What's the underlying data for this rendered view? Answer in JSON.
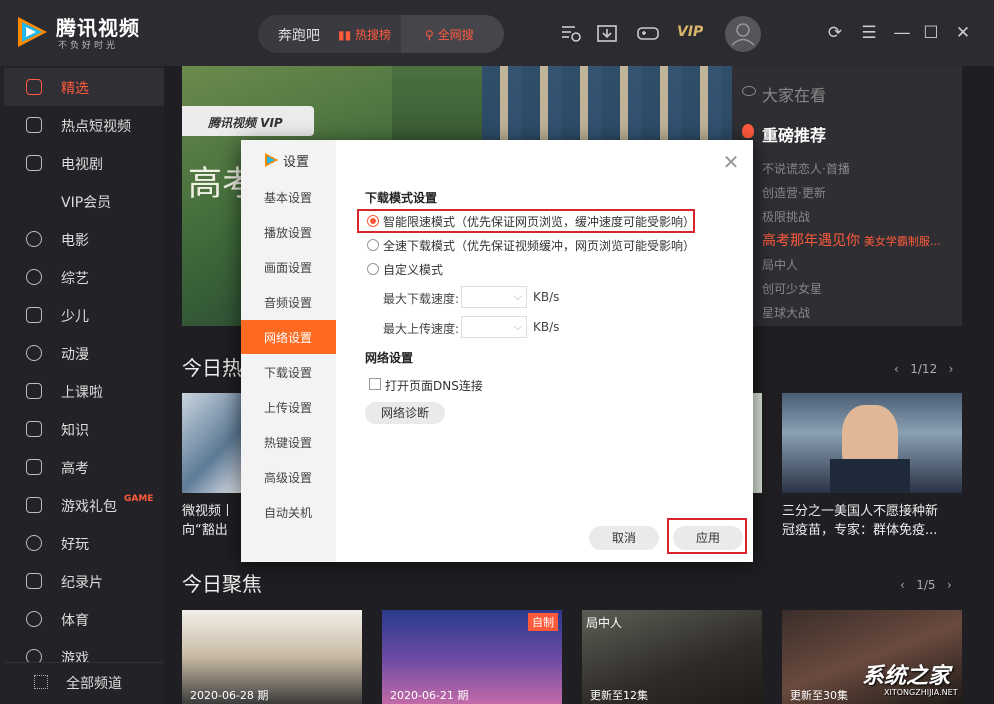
{
  "app": {
    "brand": "腾讯视频",
    "slogan": "不负好时光"
  },
  "topbar": {
    "search_text": "奔跑吧",
    "hot_search": "热搜榜",
    "full_search": "全网搜",
    "vip": "VIP",
    "icons": [
      "history-icon",
      "download-icon",
      "game-icon"
    ],
    "window_controls": [
      "refresh-icon",
      "menu-icon",
      "minimize-icon",
      "maximize-icon",
      "close-icon"
    ]
  },
  "sidebar": {
    "items": [
      {
        "label": "精选",
        "icon": "thumbs-up-icon"
      },
      {
        "label": "热点短视频",
        "icon": "flame-icon"
      },
      {
        "label": "电视剧",
        "icon": "tv-icon"
      },
      {
        "label": "VIP会员",
        "icon": ""
      },
      {
        "label": "电影",
        "icon": "film-reel-icon"
      },
      {
        "label": "综艺",
        "icon": "microphone-icon"
      },
      {
        "label": "少儿",
        "icon": "kids-icon"
      },
      {
        "label": "动漫",
        "icon": "bear-icon"
      },
      {
        "label": "上课啦",
        "icon": "graduation-cap-icon"
      },
      {
        "label": "知识",
        "icon": "book-icon"
      },
      {
        "label": "高考",
        "icon": "school-icon"
      },
      {
        "label": "游戏礼包",
        "icon": "gamepad-icon"
      },
      {
        "label": "好玩",
        "icon": "joystick-icon"
      },
      {
        "label": "纪录片",
        "icon": "camera-icon"
      },
      {
        "label": "体育",
        "icon": "basketball-icon"
      },
      {
        "label": "游戏",
        "icon": "controller-icon"
      }
    ],
    "active_index": 0,
    "game_badge": "GAME",
    "all_channels": "全部频道"
  },
  "banner": {
    "vip_logo": "腾讯视频 VIP",
    "calligraphy": "高考"
  },
  "now_watching": {
    "title": "大家在看",
    "hot_recommend": "重磅推荐",
    "items": [
      "不说谎恋人·首播",
      "创造营·更新",
      "极限挑战"
    ],
    "highlight": "高考那年遇见你",
    "highlight_sub": "美女学霸制服...",
    "items_after": [
      "局中人",
      "创可少女星",
      "星球大战"
    ]
  },
  "sections": {
    "today_hot": {
      "title": "今日热",
      "pager": "1/12"
    },
    "today_focus": {
      "title": "今日聚焦",
      "pager": "1/5"
    }
  },
  "hot_cards": [
    {
      "caption_line1": "微视频丨",
      "caption_line2": "向“豁出"
    },
    {
      "caption_line1": "三分之一美国人不愿接种新",
      "caption_line2": "冠疫苗，专家：群体免疫..."
    }
  ],
  "focus_cards": [
    {
      "date": "2020-06-28 期"
    },
    {
      "date": "2020-06-21 期",
      "tag": "自制"
    },
    {
      "date": "更新至12集",
      "overlay": "局中人"
    },
    {
      "date": "更新至30集"
    }
  ],
  "dialog": {
    "title": "设置",
    "nav": [
      "基本设置",
      "播放设置",
      "画面设置",
      "音频设置",
      "网络设置",
      "下载设置",
      "上传设置",
      "热键设置",
      "高级设置",
      "自动关机"
    ],
    "active_nav": 4,
    "download_section": "下载模式设置",
    "modes": [
      {
        "label": "智能限速模式（优先保证网页浏览，缓冲速度可能受影响）",
        "checked": true
      },
      {
        "label": "全速下载模式（优先保证视频缓冲，网页浏览可能受影响）",
        "checked": false
      },
      {
        "label": "自定义模式",
        "checked": false
      }
    ],
    "max_download": {
      "label": "最大下载速度:",
      "unit": "KB/s",
      "value": ""
    },
    "max_upload": {
      "label": "最大上传速度:",
      "unit": "KB/s",
      "value": ""
    },
    "network_section": "网络设置",
    "dns_label": "打开页面DNS连接",
    "dns_checked": false,
    "diag_button": "网络诊断",
    "cancel_button": "取消",
    "apply_button": "应用"
  },
  "watermark": {
    "text": "系统之家",
    "url": "XITONGZHIJIA.NET"
  },
  "colors": {
    "accent": "#ff5a3c",
    "active_nav": "#ff6a22",
    "highlight_box": "#d8262c"
  }
}
